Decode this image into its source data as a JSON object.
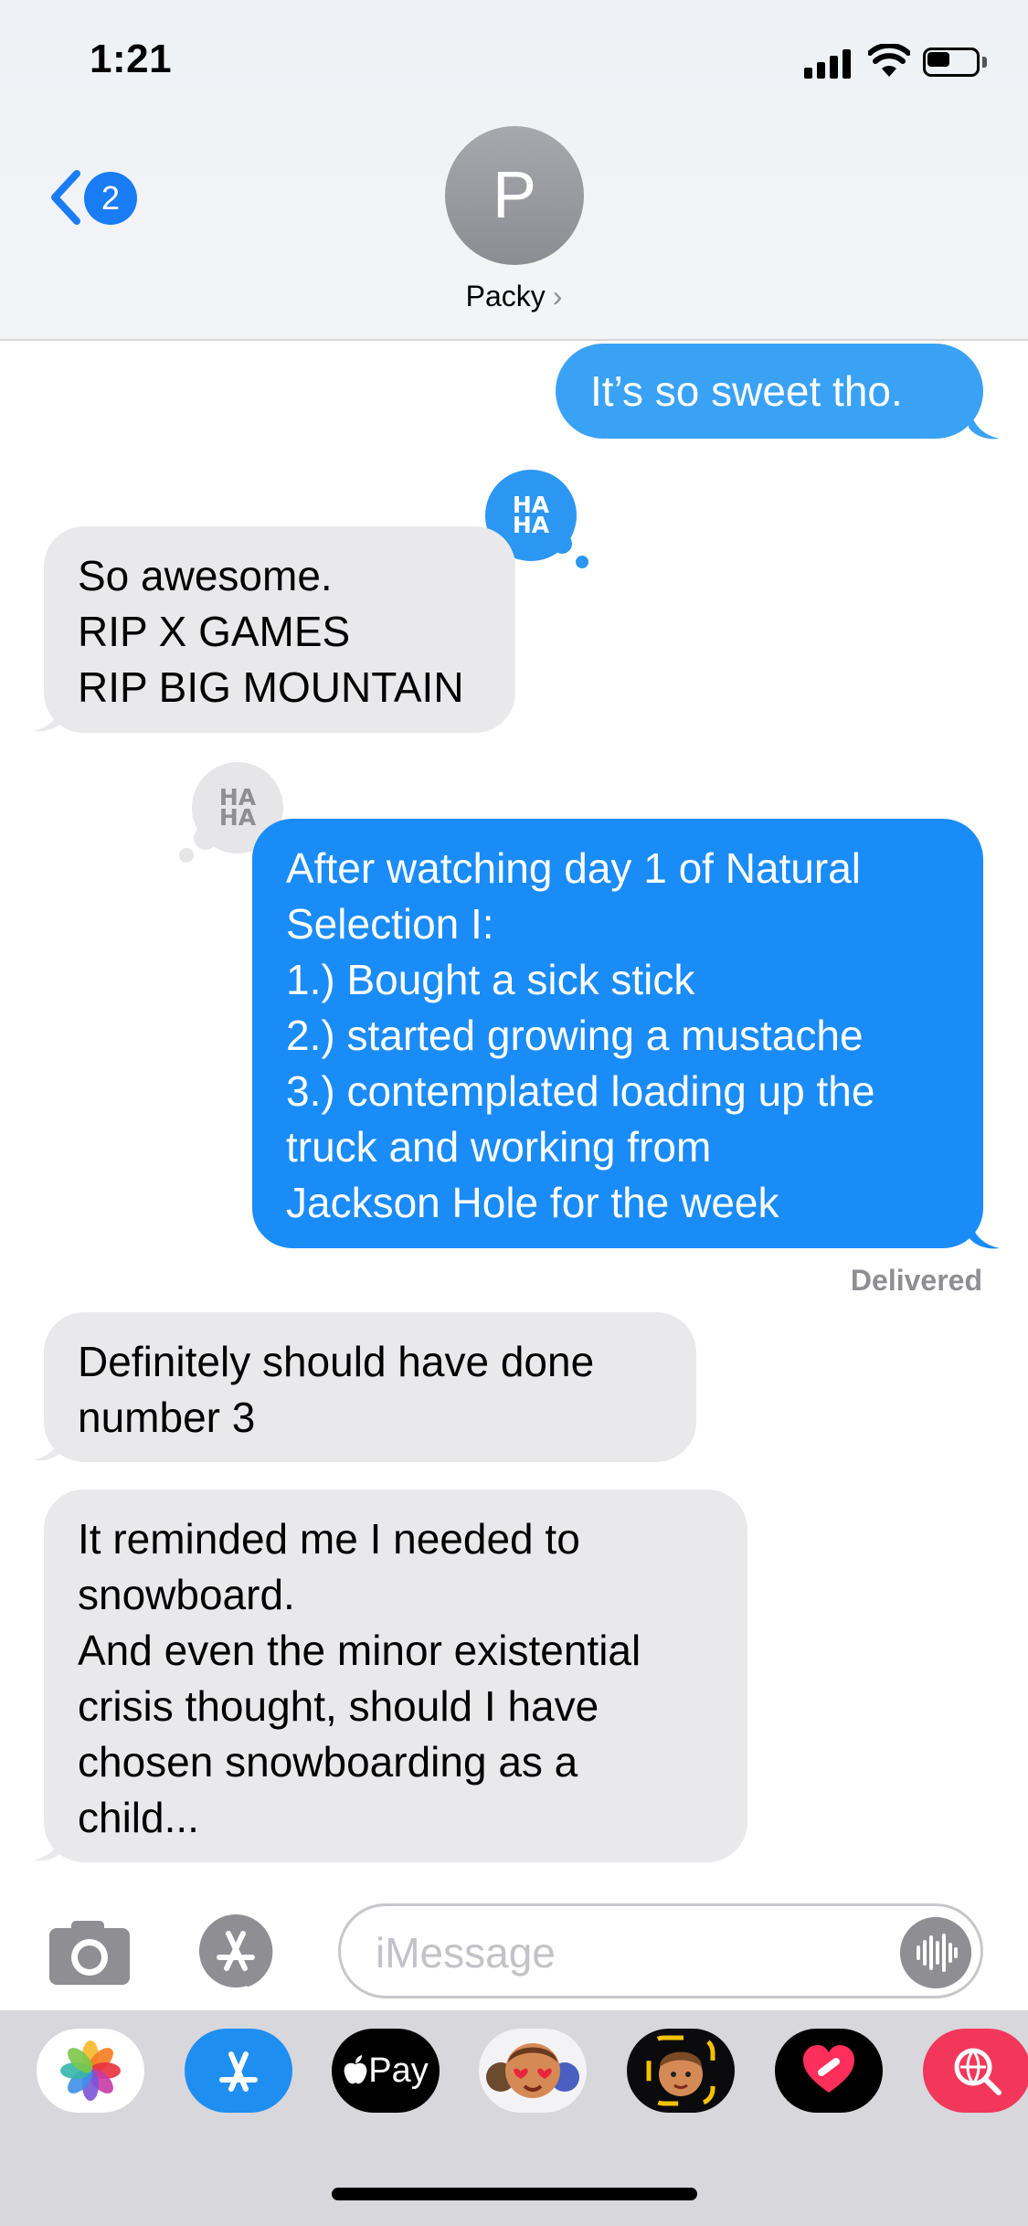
{
  "status_bar": {
    "time": "1:21"
  },
  "nav": {
    "back_badge": "2",
    "avatar_initial": "P",
    "contact_name": "Packy",
    "contact_chevron": "›"
  },
  "messages": {
    "m1": {
      "lines": [
        "It’s so sweet tho."
      ]
    },
    "m2": {
      "lines": [
        "So awesome.",
        "RIP X GAMES",
        "RIP BIG MOUNTAIN"
      ],
      "tapback_line1": "HA",
      "tapback_line2": "HA"
    },
    "m3": {
      "lines": [
        "After watching day 1 of Natural",
        "Selection I:",
        "1.) Bought a sick stick",
        "2.) started growing a mustache",
        "3.) contemplated loading up the",
        "truck and working from",
        "Jackson Hole for the week"
      ],
      "tapback_line1": "HA",
      "tapback_line2": "HA"
    },
    "delivered": "Delivered",
    "m4": {
      "lines": [
        "Definitely should have done",
        "number 3"
      ]
    },
    "m5": {
      "lines": [
        "It reminded me I needed to",
        "snowboard.",
        "And even the minor existential",
        "crisis thought, should I have",
        "chosen snowboarding as a",
        "child..."
      ]
    }
  },
  "input": {
    "placeholder": "iMessage"
  },
  "drawer": {
    "apps": [
      "photos-icon",
      "app-store-icon",
      "apple-pay-icon",
      "memoji-stickers-icon",
      "memoji-icon",
      "digital-touch-icon",
      "web-images-icon"
    ],
    "apple_pay_label": "Pay"
  },
  "colors": {
    "sent": "#1a8cf8",
    "received": "#e9e9eb",
    "accent": "#1a7cf5"
  }
}
